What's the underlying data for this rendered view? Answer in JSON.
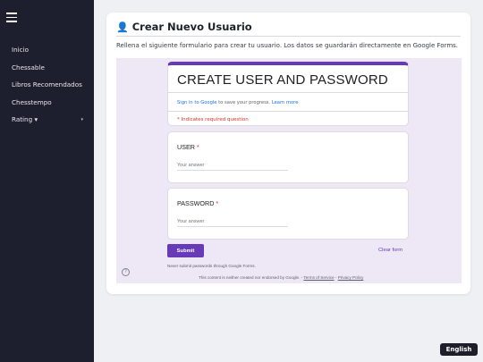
{
  "sidebar": {
    "items": [
      {
        "label": "Inicio"
      },
      {
        "label": "Chessable"
      },
      {
        "label": "Libros Recomendados"
      },
      {
        "label": "Chesstempo"
      },
      {
        "label": "Rating ▾",
        "caret": "▾"
      }
    ]
  },
  "main": {
    "title_icon": "👤",
    "title": "Crear Nuevo Usuario",
    "description": "Rellena el siguiente formulario para crear tu usuario. Los datos se guardarán directamente en Google Forms."
  },
  "form": {
    "title": "CREATE USER AND PASSWORD",
    "sign_in_link": "Sign in to Google",
    "sign_in_text": " to save your progress. ",
    "learn_more": "Learn more",
    "required_note": "* Indicates required question",
    "questions": [
      {
        "label": "USER",
        "required_mark": "*",
        "placeholder": "Your answer"
      },
      {
        "label": "PASSWORD",
        "required_mark": "*",
        "placeholder": "Your answer"
      }
    ],
    "submit_label": "Submit",
    "clear_label": "Clear form",
    "help_icon": "?",
    "never_submit": "Never submit passwords through Google Forms.",
    "footer_text": "This content is neither created nor endorsed by Google. - ",
    "terms": "Terms of Service",
    "footer_sep": " - ",
    "privacy": "Privacy Policy"
  },
  "language_button": "English",
  "colors": {
    "sidebar_bg": "#1e1f2e",
    "form_accent": "#673ab7",
    "form_bg": "#ede7f6",
    "required": "#d93025",
    "link": "#1a73e8"
  }
}
